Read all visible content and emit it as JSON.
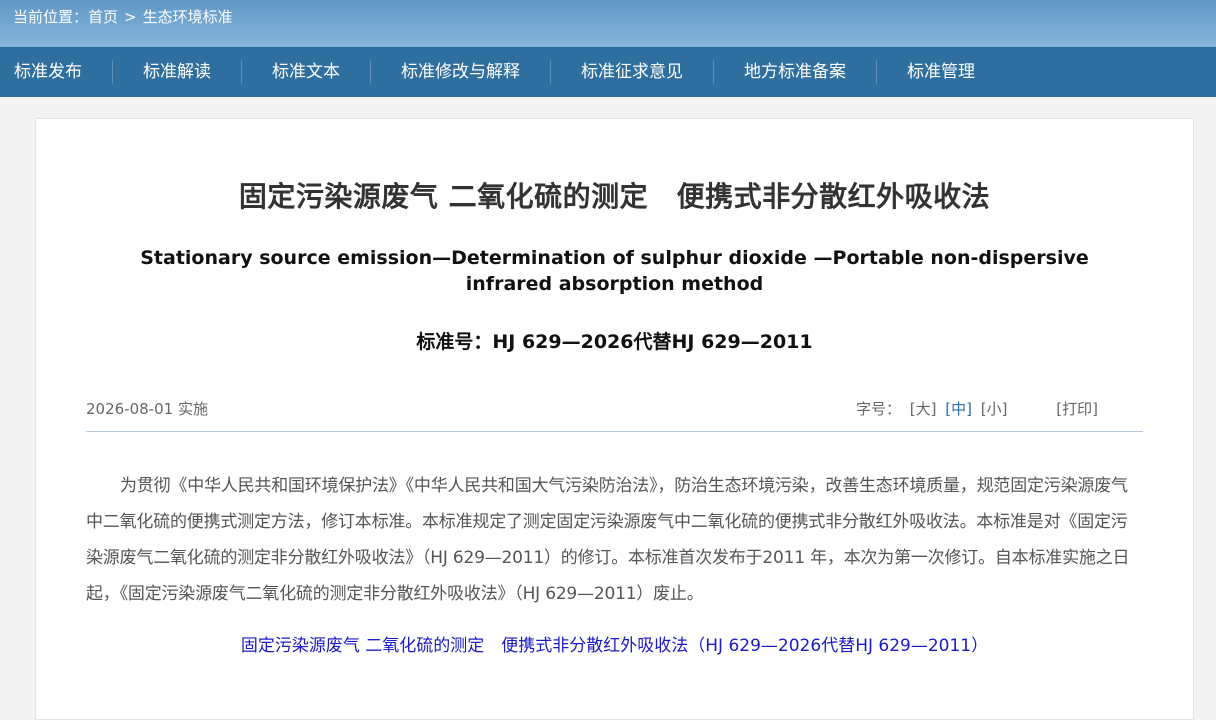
{
  "breadcrumb": {
    "prefix": "当前位置：",
    "home": "首页",
    "separator": ">",
    "current": "生态环境标准"
  },
  "nav": {
    "items": [
      "标准发布",
      "标准解读",
      "标准文本",
      "标准修改与解释",
      "标准征求意见",
      "地方标准备案",
      "标准管理"
    ]
  },
  "article": {
    "title_cn": "固定污染源废气 二氧化硫的测定　便携式非分散红外吸收法",
    "title_en": "Stationary source emission—Determination of sulphur dioxide —Portable non-dispersive infrared absorption method",
    "standard_no": "标准号：HJ 629—2026代替HJ 629—2011",
    "date": "2026-08-01 实施",
    "font_label": "字号：",
    "font_large": "[大]",
    "font_medium": "[中]",
    "font_small": "[小]",
    "print": "[打印]",
    "body": "为贯彻《中华人民共和国环境保护法》《中华人民共和国大气污染防治法》，防治生态环境污染，改善生态环境质量，规范固定污染源废气中二氧化硫的便携式测定方法，修订本标准。本标准规定了测定固定污染源废气中二氧化硫的便携式非分散红外吸收法。本标准是对《固定污染源废气二氧化硫的测定非分散红外吸收法》（HJ 629—2011）的修订。本标准首次发布于2011 年，本次为第一次修订。自本标准实施之日起，《固定污染源废气二氧化硫的测定非分散红外吸收法》（HJ 629—2011）废止。",
    "attachment": "固定污染源废气 二氧化硫的测定　便携式非分散红外吸收法（HJ 629—2026代替HJ 629—2011）"
  },
  "colors": {
    "nav_bg": "#2f6f9f",
    "header_bg": "#6fa4cf",
    "link": "#1a1ac8",
    "active_font": "#2a6db0"
  }
}
